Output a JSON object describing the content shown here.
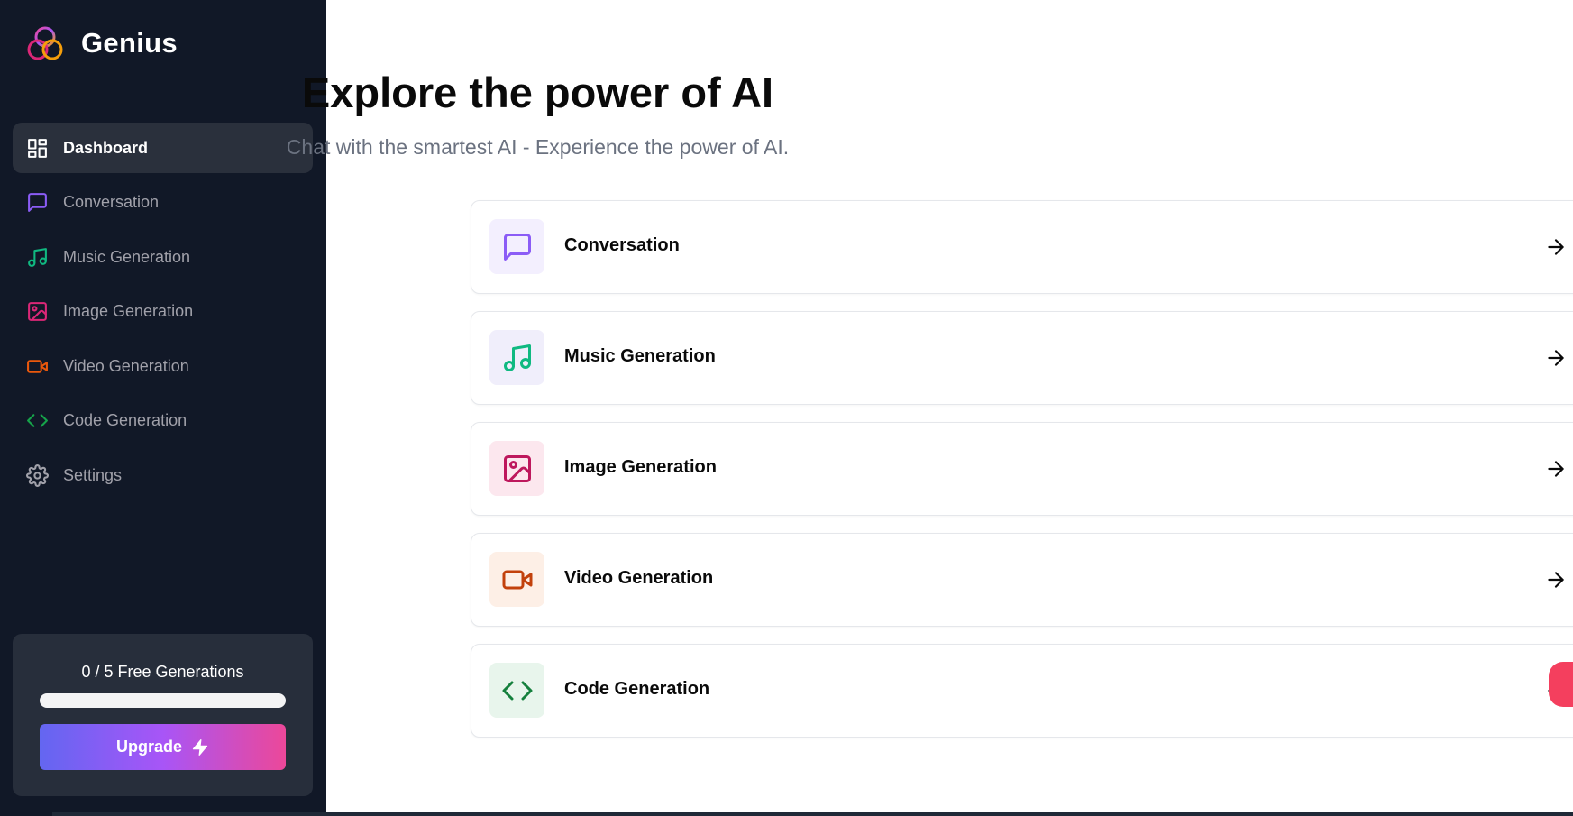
{
  "app": {
    "name": "Genius"
  },
  "sidebar": {
    "items": [
      {
        "label": "Dashboard",
        "icon": "layout-dashboard-icon",
        "color": "#ffffff",
        "active": true
      },
      {
        "label": "Conversation",
        "icon": "message-square-icon",
        "color": "#8b5cf6"
      },
      {
        "label": "Music Generation",
        "icon": "music-icon",
        "color": "#10b981"
      },
      {
        "label": "Image Generation",
        "icon": "image-icon",
        "color": "#db2777"
      },
      {
        "label": "Video Generation",
        "icon": "video-icon",
        "color": "#ea580c"
      },
      {
        "label": "Code Generation",
        "icon": "code-icon",
        "color": "#16a34a"
      },
      {
        "label": "Settings",
        "icon": "settings-icon",
        "color": "#a1a1aa"
      }
    ]
  },
  "free_card": {
    "text": "0 / 5 Free Generations",
    "used": 0,
    "limit": 5,
    "upgrade_label": "Upgrade",
    "upgrade_icon": "zap-icon"
  },
  "main": {
    "title": "Explore the power of AI",
    "subtitle": "Chat with the smartest AI - Experience the power of AI.",
    "tools": [
      {
        "label": "Conversation",
        "icon": "message-square-icon",
        "color": "#8b5cf6",
        "bg": "#f3effe"
      },
      {
        "label": "Music Generation",
        "icon": "music-icon",
        "color": "#10b981",
        "bg": "#f0eefb"
      },
      {
        "label": "Image Generation",
        "icon": "image-icon",
        "color": "#be185d",
        "bg": "#fce7ee"
      },
      {
        "label": "Video Generation",
        "icon": "video-icon",
        "color": "#c2410c",
        "bg": "#fdefe6"
      },
      {
        "label": "Code Generation",
        "icon": "code-icon",
        "color": "#15803d",
        "bg": "#e8f5ec"
      }
    ]
  }
}
